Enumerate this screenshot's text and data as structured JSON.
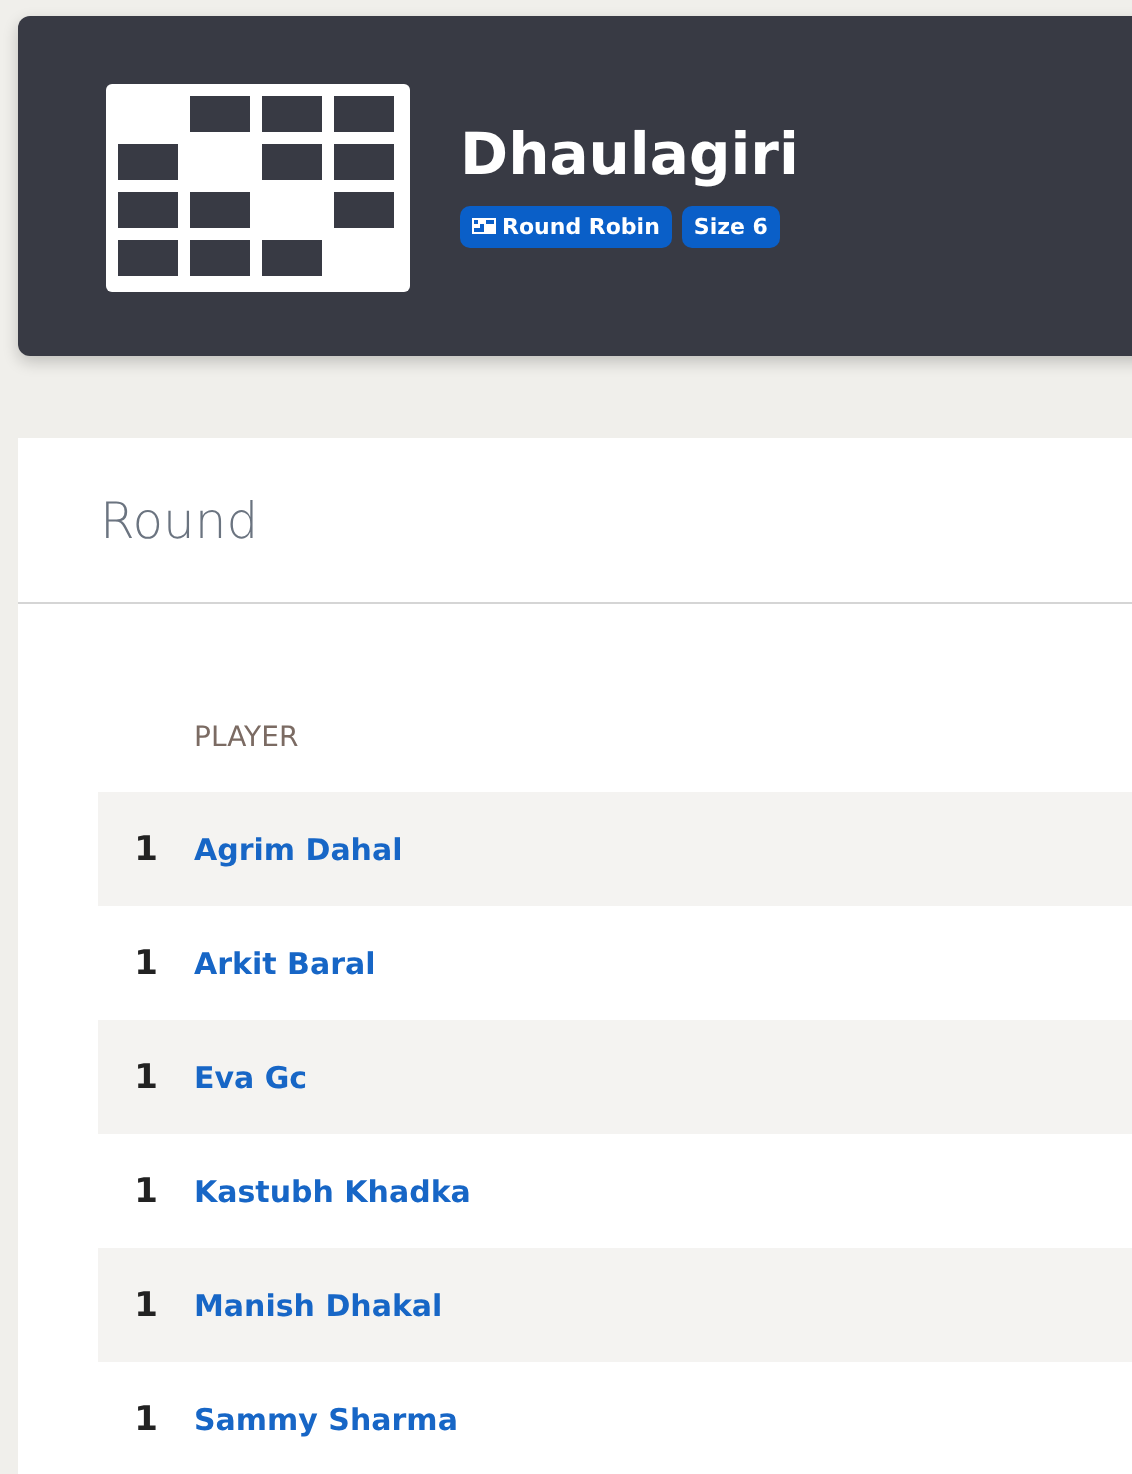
{
  "header": {
    "title": "Dhaulagiri",
    "badges": [
      {
        "kind": "format",
        "label": "Round Robin"
      },
      {
        "kind": "plain",
        "label": "Size 6"
      }
    ]
  },
  "panel": {
    "title": "Round"
  },
  "table": {
    "columns": [
      "PLAYER"
    ],
    "rows": [
      {
        "rank": "1",
        "player": "Agrim Dahal"
      },
      {
        "rank": "1",
        "player": "Arkit Baral"
      },
      {
        "rank": "1",
        "player": "Eva Gc"
      },
      {
        "rank": "1",
        "player": "Kastubh Khadka"
      },
      {
        "rank": "1",
        "player": "Manish Dhakal"
      },
      {
        "rank": "1",
        "player": "Sammy Sharma"
      }
    ]
  }
}
